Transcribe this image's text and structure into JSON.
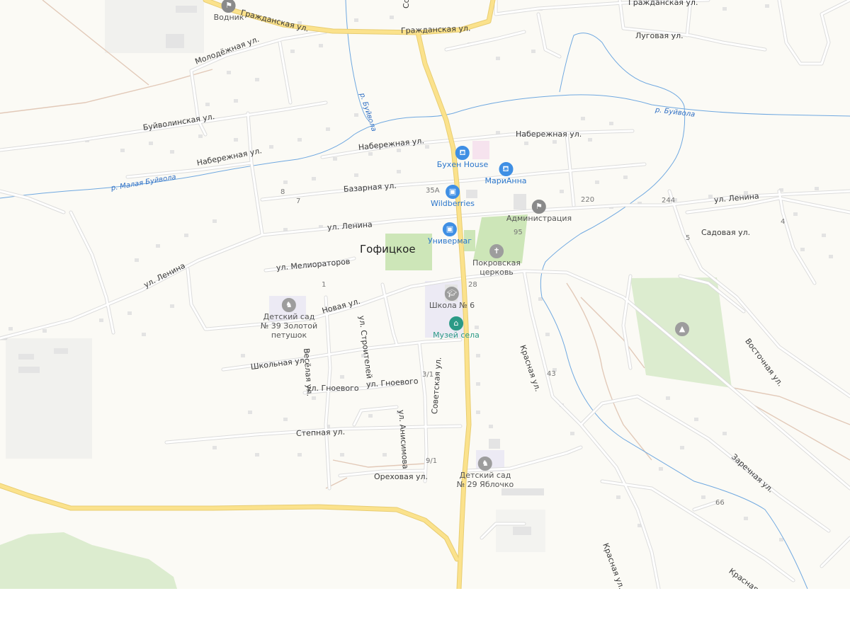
{
  "map": {
    "colors": {
      "background": "#fbfaf5",
      "road_main": "#fbe28c",
      "road_main_casing": "#e8cd72",
      "road_minor": "#e6e6e6",
      "water": "#6fa8e0",
      "park": "#dceccf",
      "building": "#e6e6e6",
      "track": "#e2c9b8"
    },
    "settlement": "Гофицкое",
    "streets": {
      "grazhdanskaya_1": "Гражданская ул.",
      "grazhdanskaya_2": "Гражданская ул.",
      "grazhdanskaya_3": "Гражданская ул.",
      "lugovaya": "Луговая ул.",
      "molodezhnaya": "Молодёжная ул.",
      "buivolinskaya": "Буйволинская ул.",
      "naberezhnaya_1": "Набережная ул.",
      "naberezhnaya_2": "Набережная ул.",
      "naberezhnaya_3": "Набережная ул.",
      "bazarnaya": "Базарная ул.",
      "lenina_1": "ул. Ленина",
      "lenina_2": "ул. Ленина",
      "lenina_3": "ул. Ленина",
      "sadovaya": "Садовая ул.",
      "melioratorov": "ул. Мелиораторов",
      "novaya": "Новая ул.",
      "stroiteley": "ул. Строителей",
      "veselaya": "Весёлая ул.",
      "shkolnaya": "Школьная ул.",
      "gnoevogo_1": "ул. Гноевого",
      "gnoevogo_2": "ул. Гноевого",
      "anisimova": "ул. Анисимова",
      "stepnaya": "Степная ул.",
      "orekhovaya": "Ореховая ул.",
      "sovetskaya": "Советская ул.",
      "krasnaya_1": "Красная ул.",
      "krasnaya_2": "Красная ул.",
      "krasnaya_3": "Красная ул.",
      "zarechnaya": "Заречная ул.",
      "vostochnaya": "Восточная ул.",
      "sov_top": "Со"
    },
    "rivers": {
      "buivola_1": "р. Буйвола",
      "buivola_2": "р. Буйвола",
      "malaya_buivola": "р. Малая Буйвола"
    },
    "house_numbers": {
      "n8": "8",
      "n7": "7",
      "n35a": "35А",
      "n220": "220",
      "n244": "244",
      "n4": "4",
      "n5": "5",
      "n95": "95",
      "n1": "1",
      "n28": "28",
      "n43": "43",
      "n3_1": "3/1",
      "n9_1": "9/1",
      "n66": "66"
    },
    "pois": {
      "vodnik": {
        "name": "Водник",
        "icon": "flag-icon"
      },
      "buhen": {
        "name": "Бухен House",
        "icon": "shopping-basket-icon"
      },
      "marianna": {
        "name": "МариАнна",
        "icon": "shopping-basket-icon"
      },
      "wildberries": {
        "name": "Wildberries",
        "icon": "shopping-bag-icon"
      },
      "administration": {
        "name": "Администрация",
        "icon": "flag-icon"
      },
      "univermag": {
        "name": "Универмаг",
        "icon": "shopping-bag-icon"
      },
      "church": {
        "name_line1": "Покровская",
        "name_line2": "церковь",
        "icon": "cross-icon"
      },
      "school": {
        "name": "Школа № 6",
        "icon": "graduation-cap-icon"
      },
      "museum": {
        "name": "Музей села",
        "icon": "museum-icon"
      },
      "kindergarten39": {
        "name_line1": "Детский сад",
        "name_line2": "№ 39 Золотой",
        "name_line3": "петушок",
        "icon": "rocking-horse-icon"
      },
      "kindergarten29": {
        "name_line1": "Детский сад",
        "name_line2": "№ 29 Яблочко",
        "icon": "rocking-horse-icon"
      },
      "monument": {
        "icon": "monument-icon"
      }
    }
  }
}
